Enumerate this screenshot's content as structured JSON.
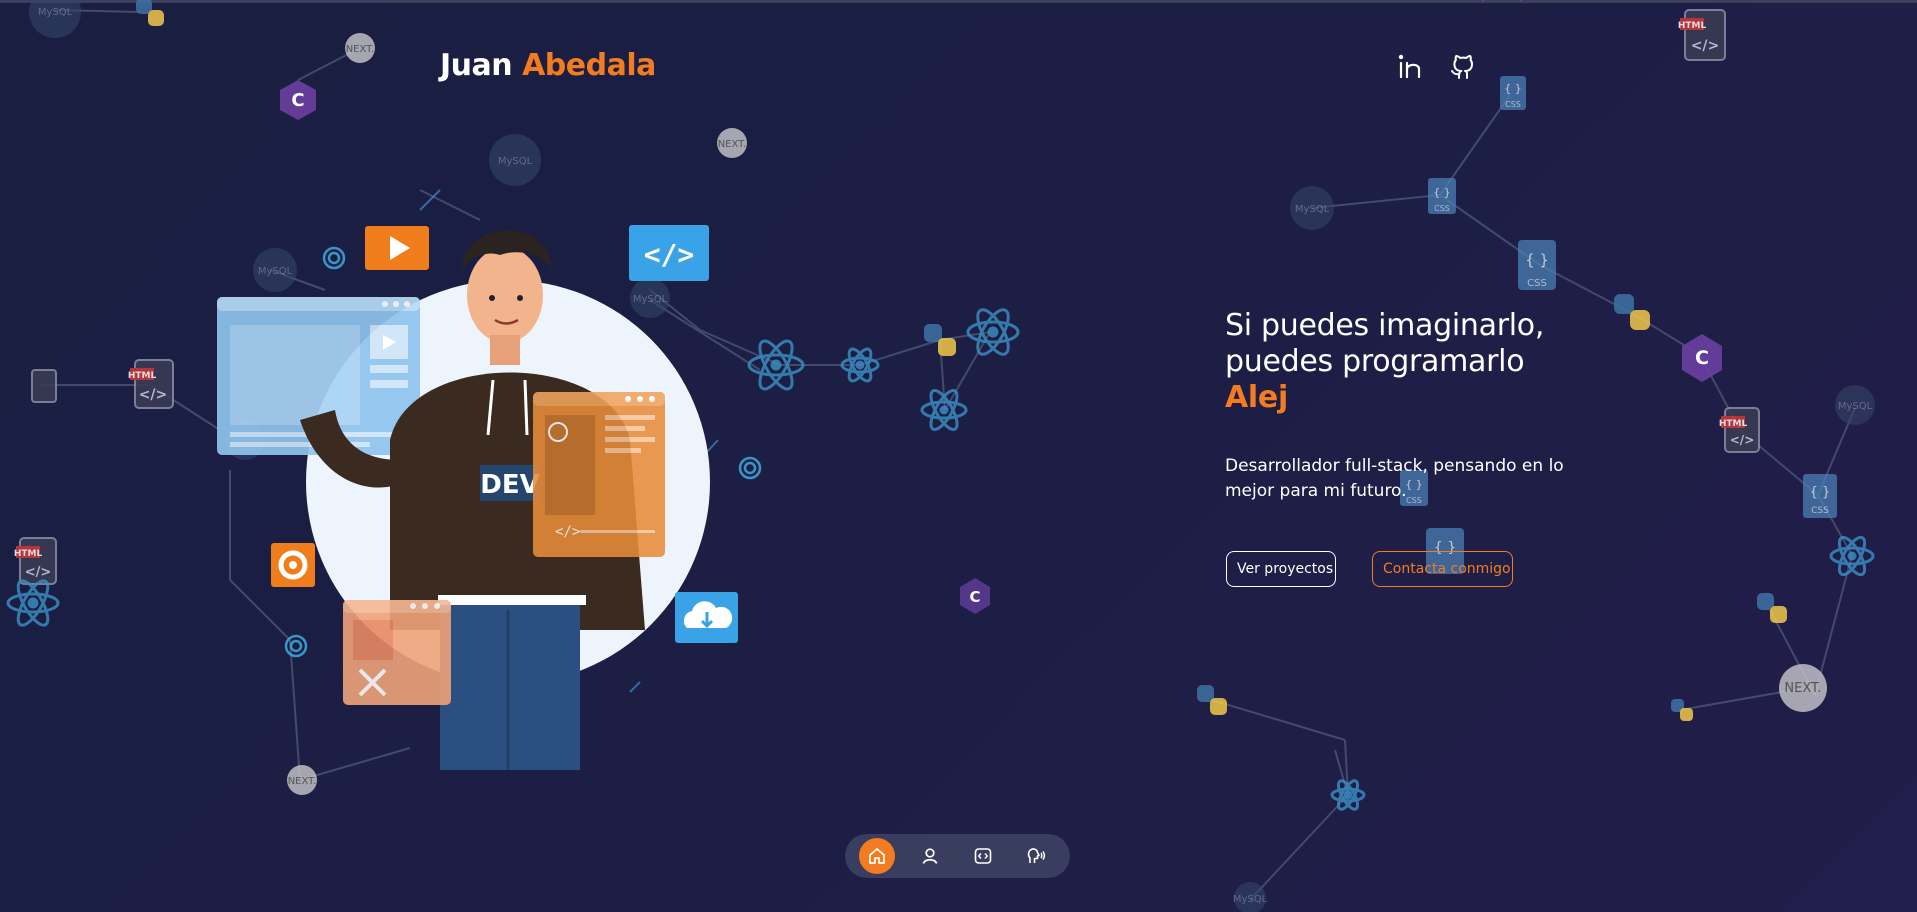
{
  "brand": {
    "first_name": "Juan",
    "last_name": "Abedala"
  },
  "social": [
    {
      "name": "linkedin",
      "icon": "linkedin-icon"
    },
    {
      "name": "github",
      "icon": "github-icon"
    }
  ],
  "hero": {
    "headline_line1": "Si puedes imaginarlo,",
    "headline_line2": "puedes programarlo",
    "headline_accent": "Alej",
    "subtitle": "Desarrollador full-stack, pensando en lo mejor para mi futuro.",
    "primary_button": "Ver proyectos",
    "secondary_button": "Contacta conmigo",
    "illustration_label": "DEV"
  },
  "background_logos": {
    "mysql": "MySQL",
    "next": "NEXT.",
    "html": "HTML",
    "css": "CSS"
  },
  "dock": [
    {
      "name": "home",
      "icon": "home-icon",
      "active": true
    },
    {
      "name": "about",
      "icon": "user-icon",
      "active": false
    },
    {
      "name": "projects",
      "icon": "code-icon",
      "active": false
    },
    {
      "name": "contact",
      "icon": "speaking-icon",
      "active": false
    }
  ],
  "colors": {
    "background": "#1c1e44",
    "accent": "#f47c20",
    "text": "#ffffff",
    "dock": "#3a3e5e"
  }
}
